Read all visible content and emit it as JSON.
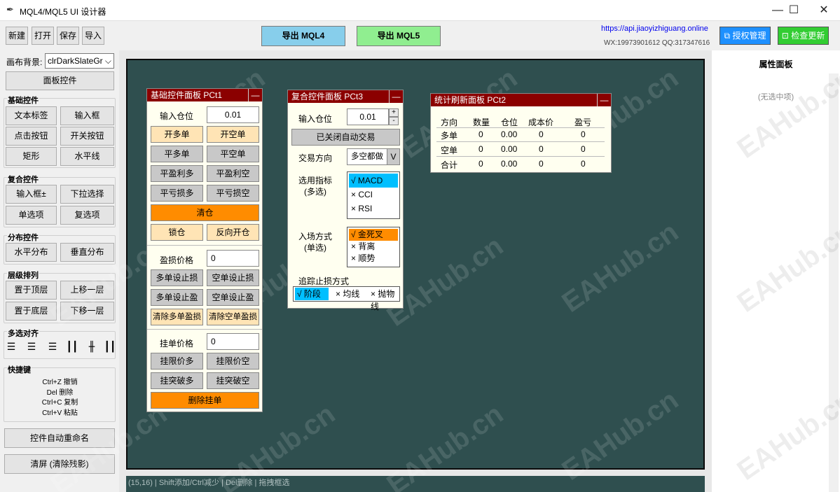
{
  "window": {
    "title": "MQL4/MQL5 UI 设计器",
    "minimize": "—",
    "maximize": "☐",
    "close": "✕"
  },
  "toolbar": {
    "new": "新建",
    "open": "打开",
    "save": "保存",
    "import": "导入",
    "export_mql4": "导出 MQL4",
    "export_mql5": "导出 MQL5",
    "link": "https://api.jiaoyizhiguang.online",
    "contact": "WX:19973901612  QQ:317347616",
    "license": "授权管理",
    "update": "检查更新",
    "colors": {
      "mql4": "#87ceeb",
      "mql5": "#90ee90",
      "license": "#1e90ff",
      "update": "#32cd32"
    }
  },
  "left": {
    "bg_label": "画布背景:",
    "bg_value": "clrDarkSlateGr",
    "panel_control": "面板控件",
    "basic_head": "基础控件",
    "basic": [
      "文本标签",
      "输入框",
      "点击按钮",
      "开关按钮",
      "矩形",
      "水平线"
    ],
    "composite_head": "复合控件",
    "composite": [
      "输入框±",
      "下拉选择",
      "单选项",
      "复选项"
    ],
    "dist_head": "分布控件",
    "dist": [
      "水平分布",
      "垂直分布"
    ],
    "layer_head": "层级排列",
    "layer": [
      "置于顶层",
      "上移一层",
      "置于底层",
      "下移一层"
    ],
    "align_head": "多选对齐",
    "align_icons": [
      "align-left-icon",
      "align-center-icon",
      "align-right-icon",
      "align-top-icon",
      "align-middle-icon",
      "align-bottom-icon"
    ],
    "shortcut_head": "快捷键",
    "shortcuts": [
      "Ctrl+Z 撤销",
      "Del 删除",
      "Ctrl+C 复制",
      "Ctrl+V 粘贴"
    ],
    "auto_rename": "控件自动重命名",
    "clear": "清屏 (清除残影)"
  },
  "status": "(15,16) | Shift添加/Ctrl减少 | Del删除 | 拖拽框选",
  "right": {
    "title": "属性面板",
    "empty": "(无选中项)"
  },
  "watermark": "EAHub.cn",
  "panel1": {
    "title": "基础控件面板 PCt1",
    "min": "—",
    "lots_label": "输入仓位",
    "lots_value": "0.01",
    "open_buy": "开多单",
    "open_sell": "开空单",
    "close_buy": "平多单",
    "close_sell": "平空单",
    "close_profit_buy": "平盈利多",
    "close_profit_sell": "平盈利空",
    "close_loss_buy": "平亏损多",
    "close_loss_sell": "平亏损空",
    "clear_pos": "清仓",
    "lock": "锁仓",
    "reverse": "反向开仓",
    "sltp_label": "盈损价格",
    "sltp_value": "0",
    "buy_sl": "多单设止损",
    "sell_sl": "空单设止损",
    "buy_tp": "多单设止盈",
    "sell_tp": "空单设止盈",
    "clear_buy_sltp": "清除多单盈损",
    "clear_sell_sltp": "清除空单盈损",
    "pending_label": "挂单价格",
    "pending_value": "0",
    "buy_limit": "挂限价多",
    "sell_limit": "挂限价空",
    "buy_stop": "挂突破多",
    "sell_stop": "挂突破空",
    "delete_pending": "删除挂单"
  },
  "panel3": {
    "title": "复合控件面板 PCt3",
    "min": "—",
    "lots_label": "输入仓位",
    "lots_value": "0.01",
    "up": "+",
    "down": "-",
    "auto_trade": "已关闭自动交易",
    "dir_label": "交易方向",
    "dir_value": "多空都做",
    "dir_btn": "V",
    "ind_label1": "选用指标",
    "ind_label2": "(多选)",
    "indicators": [
      "√ MACD",
      "× CCI",
      "× RSI"
    ],
    "entry_label1": "入场方式",
    "entry_label2": "(单选)",
    "entries": [
      "√ 金死叉",
      "× 背离",
      "× 顺势"
    ],
    "trail_label": "追踪止损方式",
    "trails": [
      "√ 阶段",
      "× 均线",
      "× 抛物线"
    ]
  },
  "panel2": {
    "title": "统计刷新面板 PCt2",
    "min": "—",
    "headers": [
      "方向",
      "数量",
      "仓位",
      "成本价",
      "盈亏"
    ],
    "rows": [
      [
        "多单",
        "0",
        "0.00",
        "0",
        "0"
      ],
      [
        "空单",
        "0",
        "0.00",
        "0",
        "0"
      ],
      [
        "合计",
        "0",
        "0.00",
        "0",
        "0"
      ]
    ]
  }
}
